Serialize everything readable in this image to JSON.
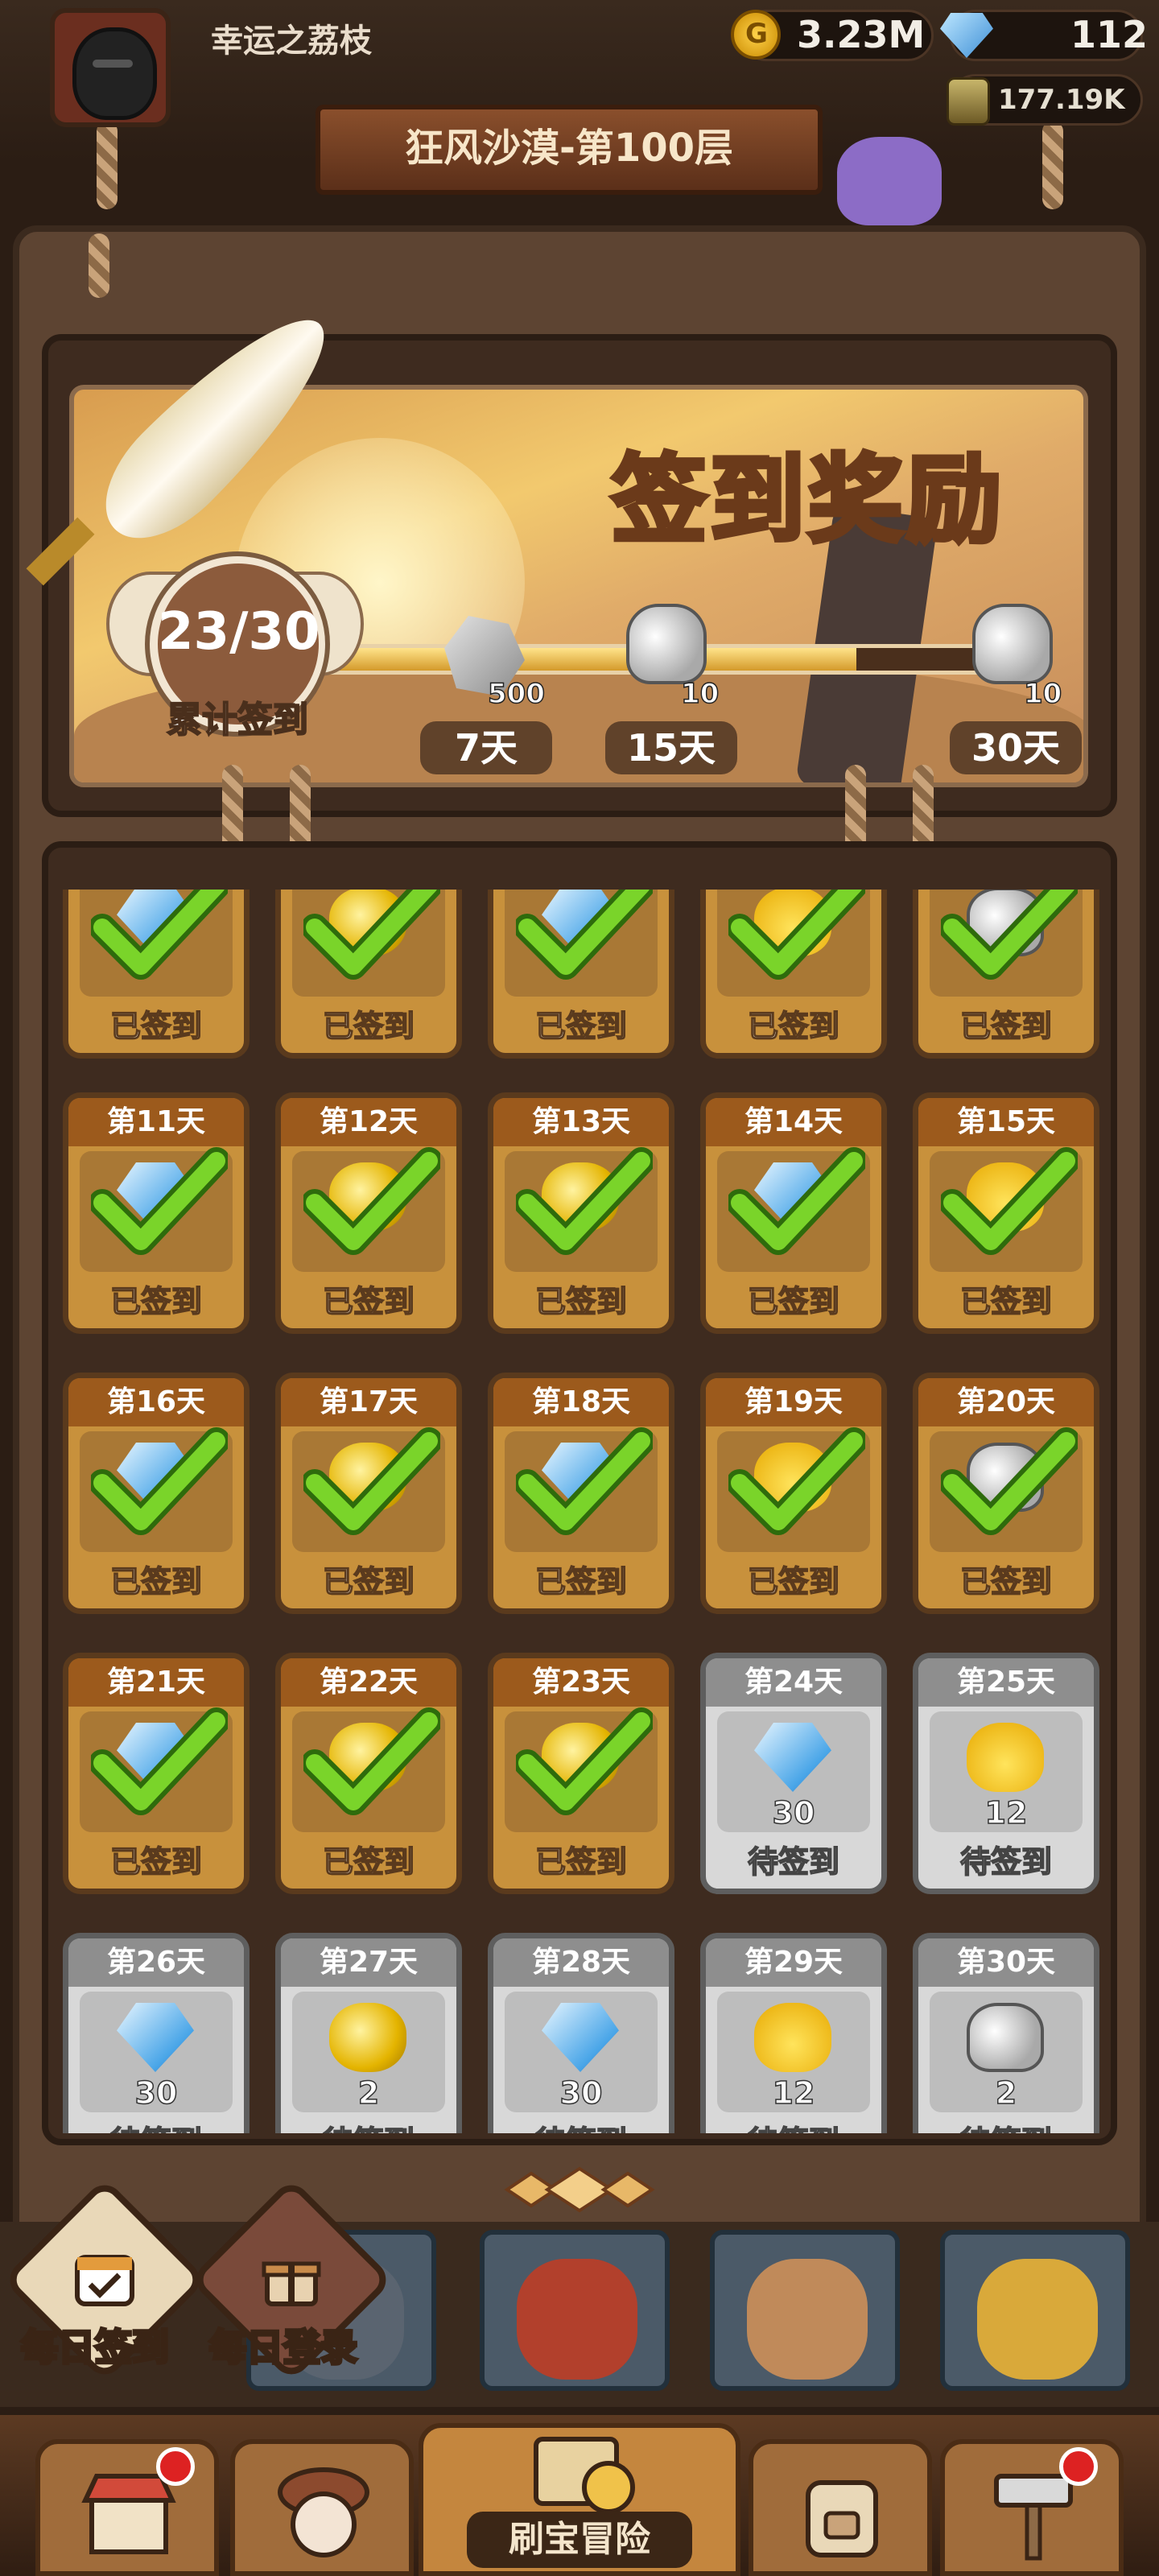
{
  "player": {
    "name": "幸运之荔枝"
  },
  "resources": {
    "gold": "3.23M",
    "gems": "112",
    "ore": "177.19K"
  },
  "stage": {
    "title": "狂风沙漠-第100层"
  },
  "signin": {
    "banner_title": "签到奖励",
    "count": "23/30",
    "count_label": "累计签到",
    "progress": 0.78,
    "milestones": [
      {
        "icon": "ore-icon",
        "qty": "500",
        "day": "7天"
      },
      {
        "icon": "scroll-icon",
        "qty": "10",
        "day": "15天"
      },
      {
        "icon": "scroll-icon",
        "qty": "10",
        "day": "30天"
      }
    ]
  },
  "days_partial": [
    {
      "icon": "gem",
      "state": "done",
      "status": "已签到"
    },
    {
      "icon": "gold-scroll",
      "state": "done",
      "status": "已签到"
    },
    {
      "icon": "gem",
      "state": "done",
      "status": "已签到"
    },
    {
      "icon": "duck",
      "state": "done",
      "status": "已签到"
    },
    {
      "icon": "silver-scroll",
      "state": "done",
      "status": "已签到"
    }
  ],
  "days": [
    {
      "label": "第11天",
      "icon": "gem",
      "state": "done",
      "status": "已签到"
    },
    {
      "label": "第12天",
      "icon": "gold-scroll",
      "state": "done",
      "status": "已签到"
    },
    {
      "label": "第13天",
      "icon": "gold-scroll",
      "state": "done",
      "status": "已签到"
    },
    {
      "label": "第14天",
      "icon": "gem",
      "state": "done",
      "status": "已签到"
    },
    {
      "label": "第15天",
      "icon": "duck",
      "state": "done",
      "status": "已签到"
    },
    {
      "label": "第16天",
      "icon": "gem",
      "state": "done",
      "status": "已签到"
    },
    {
      "label": "第17天",
      "icon": "gold-scroll",
      "state": "done",
      "status": "已签到"
    },
    {
      "label": "第18天",
      "icon": "gem",
      "state": "done",
      "status": "已签到"
    },
    {
      "label": "第19天",
      "icon": "duck",
      "state": "done",
      "status": "已签到"
    },
    {
      "label": "第20天",
      "icon": "silver-scroll",
      "state": "done",
      "status": "已签到"
    },
    {
      "label": "第21天",
      "icon": "gem",
      "state": "done",
      "status": "已签到"
    },
    {
      "label": "第22天",
      "icon": "gold-scroll",
      "state": "done",
      "status": "已签到"
    },
    {
      "label": "第23天",
      "icon": "gold-scroll",
      "state": "done",
      "status": "已签到"
    },
    {
      "label": "第24天",
      "icon": "gem",
      "qty": "30",
      "state": "pend",
      "status": "待签到"
    },
    {
      "label": "第25天",
      "icon": "duck",
      "qty": "12",
      "state": "pend",
      "status": "待签到"
    },
    {
      "label": "第26天",
      "icon": "gem",
      "qty": "30",
      "state": "pend",
      "status": "待签到"
    },
    {
      "label": "第27天",
      "icon": "gold-scroll",
      "qty": "2",
      "state": "pend",
      "status": "待签到"
    },
    {
      "label": "第28天",
      "icon": "gem",
      "qty": "30",
      "state": "pend",
      "status": "待签到"
    },
    {
      "label": "第29天",
      "icon": "duck",
      "qty": "12",
      "state": "pend",
      "status": "待签到"
    },
    {
      "label": "第30天",
      "icon": "silver-scroll",
      "qty": "2",
      "state": "pend",
      "status": "待签到"
    }
  ],
  "side_buttons": {
    "daily_signin": "每日签到",
    "daily_login": "每日登录"
  },
  "nav": {
    "adventure": "刷宝冒险"
  },
  "colors": {
    "done_card": "#c8913c",
    "pending_card": "#d8d8d8",
    "check_green": "#6cc11f"
  }
}
